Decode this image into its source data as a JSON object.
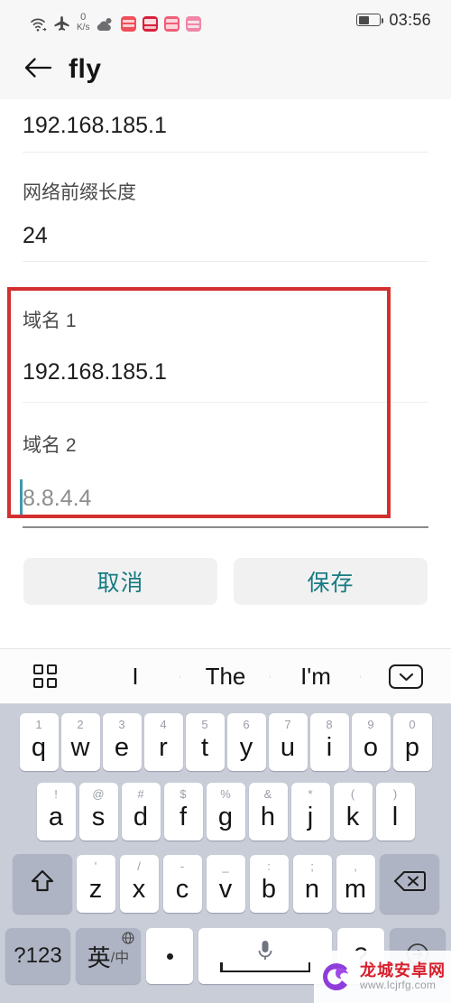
{
  "status_bar": {
    "network_speed_value": "0",
    "network_speed_unit": "K/s",
    "time": "03:56",
    "icons": [
      "wifi-icon",
      "airplane-mode-icon",
      "weather-cloud-icon",
      "app-notification-icon",
      "app-notification-icon",
      "app-notification-icon",
      "app-notification-icon",
      "battery-icon"
    ]
  },
  "app_bar": {
    "back_icon": "back-arrow-icon",
    "title": "fly"
  },
  "form": {
    "ip_value": "192.168.185.1",
    "prefix_label": "网络前缀长度",
    "prefix_value": "24",
    "dns1_label": "域名 1",
    "dns1_value": "192.168.185.1",
    "dns2_label": "域名 2",
    "dns2_placeholder": "8.8.4.4",
    "highlight_color": "#d32f2f",
    "caret_color": "#3a9aa8"
  },
  "buttons": {
    "cancel": "取消",
    "save": "保存",
    "text_color": "#167b82"
  },
  "keyboard": {
    "suggestions": [
      "I",
      "The",
      "I'm"
    ],
    "menu_icon": "grid-menu-icon",
    "collapse_icon": "collapse-keyboard-icon",
    "row1": [
      {
        "char": "q",
        "sup": "1"
      },
      {
        "char": "w",
        "sup": "2"
      },
      {
        "char": "e",
        "sup": "3"
      },
      {
        "char": "r",
        "sup": "4"
      },
      {
        "char": "t",
        "sup": "5"
      },
      {
        "char": "y",
        "sup": "6"
      },
      {
        "char": "u",
        "sup": "7"
      },
      {
        "char": "i",
        "sup": "8"
      },
      {
        "char": "o",
        "sup": "9"
      },
      {
        "char": "p",
        "sup": "0"
      }
    ],
    "row2": [
      {
        "char": "a",
        "sup": "!"
      },
      {
        "char": "s",
        "sup": "@"
      },
      {
        "char": "d",
        "sup": "#"
      },
      {
        "char": "f",
        "sup": "$"
      },
      {
        "char": "g",
        "sup": "%"
      },
      {
        "char": "h",
        "sup": "&"
      },
      {
        "char": "j",
        "sup": "*"
      },
      {
        "char": "k",
        "sup": "("
      },
      {
        "char": "l",
        "sup": ")"
      }
    ],
    "row3": [
      {
        "char": "z",
        "sup": "'"
      },
      {
        "char": "x",
        "sup": "/"
      },
      {
        "char": "c",
        "sup": "-"
      },
      {
        "char": "v",
        "sup": "_"
      },
      {
        "char": "b",
        "sup": ":"
      },
      {
        "char": "n",
        "sup": ";"
      },
      {
        "char": "m",
        "sup": ","
      }
    ],
    "shift_icon": "shift-arrow-icon",
    "backspace_icon": "backspace-icon",
    "symbols_key": "?123",
    "lang_key_main": "英",
    "lang_key_sub": "/中",
    "lang_globe_icon": "globe-icon",
    "period_key": ".",
    "space_icon": "microphone-icon",
    "question_key": "?",
    "enter_icon": "enter-icon"
  },
  "watermark": {
    "site_name": "龙城安卓网",
    "site_url": "www.lcjrfg.com",
    "logo_icon": "dragon-logo-icon"
  }
}
